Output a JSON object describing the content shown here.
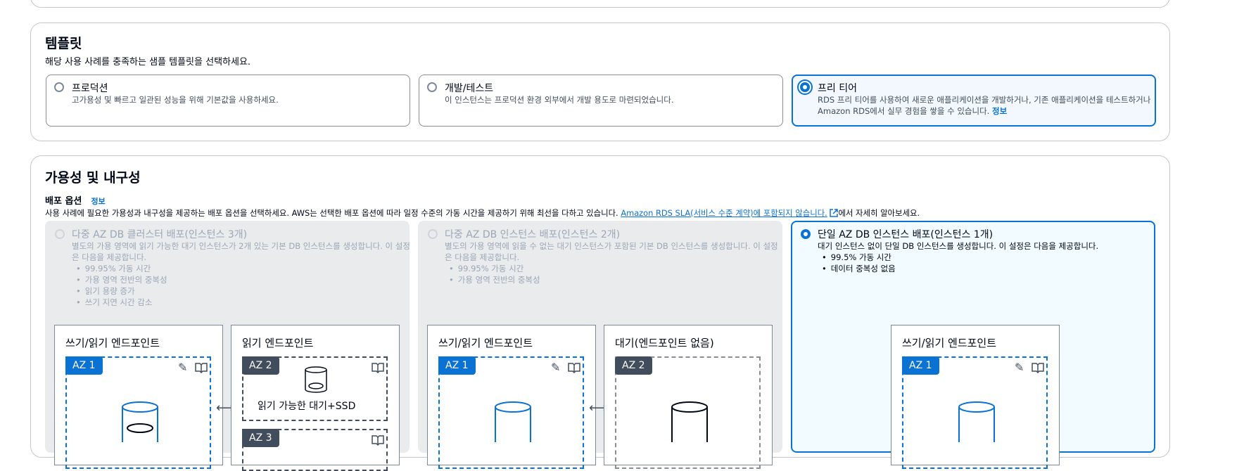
{
  "template": {
    "title": "템플릿",
    "description": "해당 사용 사례를 충족하는 샘플 템플릿을 선택하세요.",
    "options": [
      {
        "title": "프로덕션",
        "desc": "고가용성 및 빠르고 일관된 성능을 위해 기본값을 사용하세요.",
        "selected": false
      },
      {
        "title": "개발/테스트",
        "desc": "이 인스턴스는 프로덕션 환경 외부에서 개발 용도로 마련되었습니다.",
        "selected": false
      },
      {
        "title": "프리 티어",
        "desc_line1": "RDS 프리 티어를 사용하여 새로운 애플리케이션을 개발하거나, 기존 애플리케이션을 테스트하거나",
        "desc_line2": "Amazon RDS에서 실무 경험을 쌓을 수 있습니다.",
        "info": "정보",
        "selected": true
      }
    ]
  },
  "availability": {
    "title": "가용성 및 내구성",
    "deploy_label": "배포 옵션",
    "info": "정보",
    "description_pre": "사용 사례에 필요한 가용성과 내구성을 제공하는 배포 옵션을 선택하세요. AWS는 선택한 배포 옵션에 따라 일정 수준의 가동 시간을 제공하기 위해 최선을 다하고 있습니다.",
    "sla_link": "Amazon RDS SLA(서비스 수준 계약)에 포함되지 않습니다.",
    "description_post": "에서 자세히 알아보세요.",
    "options": [
      {
        "title": "다중 AZ DB 클러스터 배포(인스턴스 3개)",
        "desc_line1": "별도의 가용 영역에 읽기 가능한 대기 인스턴스가 2개 있는 기본 DB 인스턴스를 생성합니다. 이 설정",
        "desc_line2": "은 다음을 제공합니다.",
        "bullets": [
          "99.95% 가동 시간",
          "가용 영역 전반의 중복성",
          "읽기 용량 증가",
          "쓰기 지연 시간 감소"
        ],
        "disabled": true,
        "diagram": {
          "box1_title": "쓰기/읽기 엔드포인트",
          "box1_az": "AZ 1",
          "box2_title": "읽기 엔드포인트",
          "box2_az": "AZ 2",
          "box2_label": "읽기 가능한 대기+SSD",
          "box3_az": "AZ 3"
        }
      },
      {
        "title": "다중 AZ DB 인스턴스 배포(인스턴스 2개)",
        "desc_line1": "별도의 가용 영역에 읽을 수 없는 대기 인스턴스가 포함된 기본 DB 인스턴스를 생성합니다. 이 설정",
        "desc_line2": "은 다음을 제공합니다.",
        "bullets": [
          "99.95% 가동 시간",
          "가용 영역 전반의 중복성"
        ],
        "disabled": true,
        "diagram": {
          "box1_title": "쓰기/읽기 엔드포인트",
          "box1_az": "AZ 1",
          "box2_title": "대기(엔드포인트 없음)",
          "box2_az": "AZ 2"
        }
      },
      {
        "title": "단일 AZ DB 인스턴스 배포(인스턴스 1개)",
        "desc_line1": "대기 인스턴스 없이 단일 DB 인스턴스를 생성합니다. 이 설정은 다음을 제공합니다.",
        "bullets": [
          "99.5% 가동 시간",
          "데이터 중복성 없음"
        ],
        "disabled": false,
        "selected": true,
        "diagram": {
          "box1_title": "쓰기/읽기 엔드포인트",
          "box1_az": "AZ 1"
        }
      }
    ]
  },
  "icons": {
    "edit": "pencil-icon",
    "docs": "book-icon",
    "external": "external-link-icon",
    "database": "database-cylinder-icon",
    "arrow": "double-arrow-icon"
  },
  "colors": {
    "accent": "#0972d3",
    "selected_bg": "#f2f8fd",
    "disabled_bg": "#e9ebed"
  }
}
